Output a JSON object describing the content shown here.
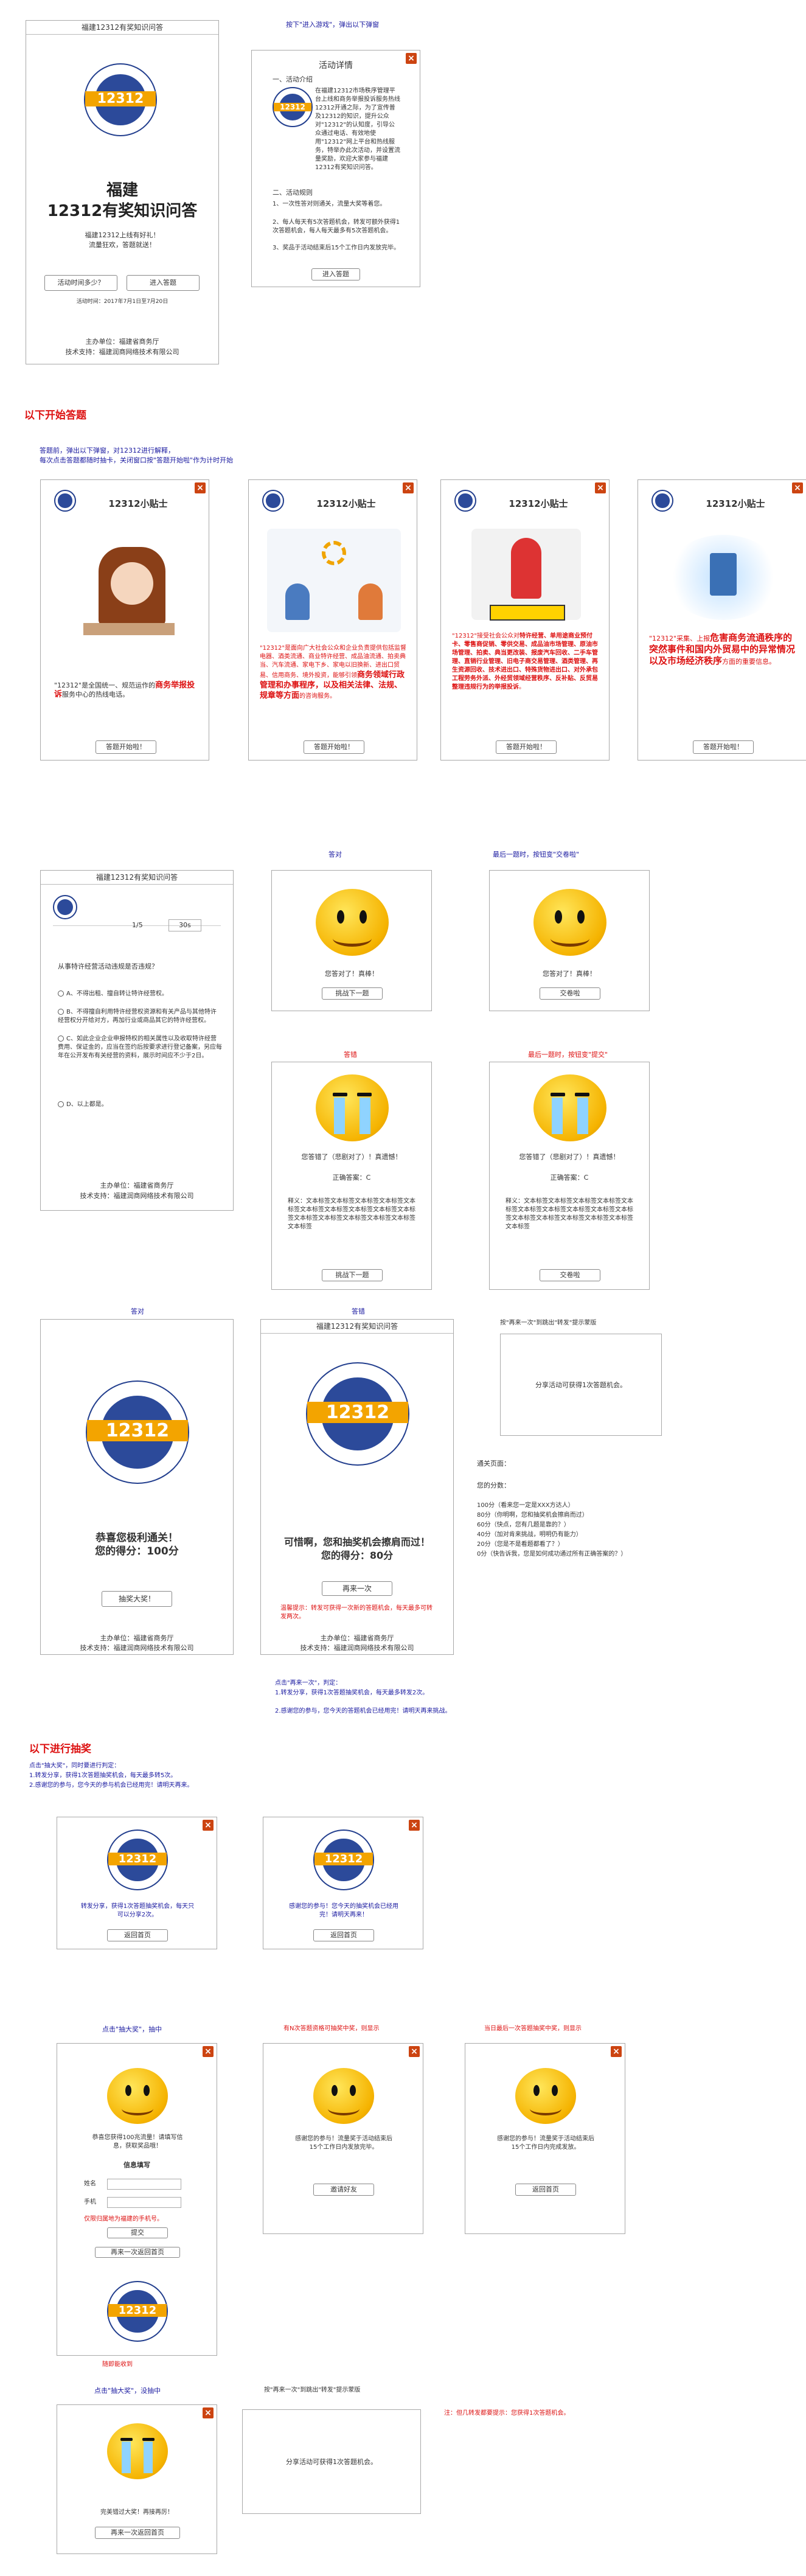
{
  "app_title": "福建12312有奖知识问答",
  "home": {
    "title_line1": "福建",
    "title_line2": "12312有奖知识问答",
    "subtitle": "福建12312上线有好礼！",
    "subtitle2": "流量狂欢，答题就送！",
    "btn_count": "活动时间多少？",
    "btn_enter": "进入答题",
    "time_note": "活动时间：2017年7月1日至7月20日",
    "org": "主办单位：福建省商务厅",
    "tech": "技术支持：福建润商网络技术有限公司"
  },
  "notes": {
    "enter_game": "按下\"进入游戏\"，弹出以下弹窗",
    "section_answer": "以下开始答题",
    "popup_intro": "答题前，弹出以下弹窗，对12312进行解释，",
    "popup_intro2": "每次点击答题都随时抽卡，关闭窗口按\"答题开始啦\"作为计时开始",
    "correct": "答对",
    "last_correct": "最后一题时，按钮变\"交卷啦\"",
    "wrong": "答错",
    "last_wrong": "最后一题时，按钮变\"提交\"",
    "correct2": "答对",
    "wrong2": "答错",
    "share_popup": "按\"再来一次\"到跳出\"转发\"提示蒙版",
    "retry_note1": "点击\"再来一次\"，判定：",
    "retry_note2": "1.转发分享，获得1次答题抽奖机会，每天最多转发2次。",
    "retry_note3": "2.感谢您的参与，您今天的答题机会已经用完！请明天再来挑战。",
    "section_lottery": "以下进行抽奖",
    "lottery_note1": "点击\"抽大奖\"，同时要进行判定：",
    "lottery_note2": "1.转发分享，获得1次答题抽奖机会，每天最多转5次。",
    "lottery_note3": "2.感谢您的参与，您今天的参与机会已经用完！请明天再来。",
    "click_win": "点击\"抽大奖\"，抽中",
    "no_stock": "有N次答题资格可抽奖中奖，则显示",
    "last_draw": "当日最后一次答题抽奖中奖，则显示",
    "success_submit": "随即能收到",
    "click_lose": "点击\"抽大奖\"，没抽中",
    "share_popup2": "按\"再来一次\"到跳出\"转发\"提示蒙版",
    "share_note_red": "注：但几转发都要提示：您获得1次答题机会。"
  },
  "activity": {
    "title": "活动详情",
    "sec1": "一、活动介绍",
    "body1": "在福建12312市场秩序管理平台上线和商务举报投诉服务热线12312开通之际，为了宣传普及12312的知识，提升公众对\"12312\"的认知度，引导公众通过电话、有效地使用\"12312\"网上平台和热线服务，特举办此次活动，并设置流量奖励，欢迎大家参与福建12312有奖知识问答。",
    "sec2": "二、活动规则",
    "rule1": "1、一次性答对则通关，流量大奖等着您。",
    "rule2": "2、每人每天有5次答题机会，转发可额外获得1次答题机会，每人每天最多有5次答题机会。",
    "rule3": "3、奖品于活动结束后15个工作日内发放完毕。",
    "btn": "进入答题"
  },
  "tips": {
    "title": "12312小贴士",
    "t1_a": "\"12312\"是全国统一、规范运作的",
    "t1_b": "商务举报投诉",
    "t1_c": "服务中心的热线电话。",
    "t2_a": "\"12312\"是面向广大社会公众和企业负责提供包括监督电器、酒类流通、商业特许经营、成品油流通、拍卖典当、汽车流通、家电下乡、家电以旧换新、进出口贸易、信用商务、境外投资，能够引领",
    "t2_b": "商务领域行政管理和办事程序，以及相关法律、法规、规章等方面",
    "t2_c": "的咨询服务。",
    "t3_a": "\"12312\"接受社会公众对",
    "t3_b": "特许经营、单用途商业预付卡、零售商促销、零供交易、成品油市场管理、原油市场管理、拍卖、典当更改装、报废汽车回收、二手车管理、直销行业管理、旧电子商交易管理、酒类管理、再生资源回收、技术进出口、特殊货物进出口、对外承包工程劳务外派、外经贸领域经营秩序、反补贴、反贸易整理违规行为的举报投诉",
    "t3_c": "。",
    "t4_a": "\"12312\"采集、上报",
    "t4_b": "危害商务流通秩序的突然事件和国内外贸易中的异常情况以及市场经济秩序",
    "t4_c": "方面的重要信息。",
    "btn": "答题开始啦！"
  },
  "quiz": {
    "progress": "1/5",
    "timer": "30s",
    "question": "从事特许经营活动违规是否违规？",
    "opt_a": "A、不得出租、擅自转让特许经营权。",
    "opt_b": "B、不得擅自利用特许经营权资源和有关产品与其他特许经营权分开给对方，再加行业或商品其它的特许经营权。",
    "opt_c": "C、如此企业企业申报特权的相关属性以及收取特许经营费用、保证金的，应当在签约后按要求进行登记备案，另应每年在公开发布有关经营的资料，展示时间应不少于2日。",
    "opt_d": "D、以上都是。",
    "org": "主办单位：福建省商务厅",
    "tech": "技术支持：福建润商网络技术有限公司"
  },
  "result": {
    "correct_text": "您答对了！真棒！",
    "btn_next": "挑战下一题",
    "btn_submit": "交卷啦",
    "wrong_text": "您答错了（悲剧对了）！真遗憾！",
    "answer": "正确答案：C",
    "explain": "释义：文本标签文本标签文本标签文本标签文本标签文本标签文本标签文本标签文本标签文本标签文本标签文本标签文本标签文本标签文本标签文本标签",
    "btn_next2": "挑战下一题",
    "btn_submit2": "交卷啦"
  },
  "final": {
    "win_title": "恭喜您极利通关！",
    "win_score": "您的得分：100分",
    "btn_draw": "抽奖大奖！",
    "lose_title": "可惜啊，您和抽奖机会擦肩而过！",
    "lose_score": "您的得分：80分",
    "btn_retry": "再来一次",
    "lose_note": "温馨提示：转发可获得一次新的答题机会，每天最多可转发两次。",
    "share_text": "分享活动可获得1次答题机会。",
    "score_title": "通关页面：",
    "score_label": "您的分数：",
    "score_100": "100分（看来您一定是XXX方达人）",
    "score_80": "80分（你明啊，您和抽奖机会擦肩而过）",
    "score_60": "60分（快点，您有几题是靠的？）",
    "score_40": "40分（加对肯来挑战，明明仍有能力）",
    "score_20": "20分（您是不是看题都看了？）",
    "score_0": "0分（快告诉我，您是如何成功通过所有正确答案的？）"
  },
  "lottery": {
    "share_ok": "转发分享，获得1次答题抽奖机会，每天只可以分享2次。",
    "btn_home": "返回首页",
    "thanks": "感谢您的参与！您今天的抽奖机会已经用完！请明天再来！",
    "btn_home2": "返回首页",
    "win_text": "恭喜您获得100兆流量！请填写信息，获取奖品哦！",
    "info_title": "信息填写",
    "name_label": "姓名",
    "phone_label": "手机",
    "phone_note": "仅限归属地为福建的手机号。",
    "btn_submit": "提交",
    "btn_back": "再来一次返回首页",
    "nostock_text": "感谢您的参与！流量奖于活动结束后15个工作日内发放完毕。",
    "btn_share": "邀请好友",
    "last_text": "感谢您的参与！流量奖于活动结束后15个工作日内完成发放。",
    "btn_home3": "返回首页",
    "lose_text": "完美错过大奖！再接再厉！",
    "btn_retry_home": "再来一次返回首页",
    "share_text2": "分享活动可获得1次答题机会。"
  }
}
